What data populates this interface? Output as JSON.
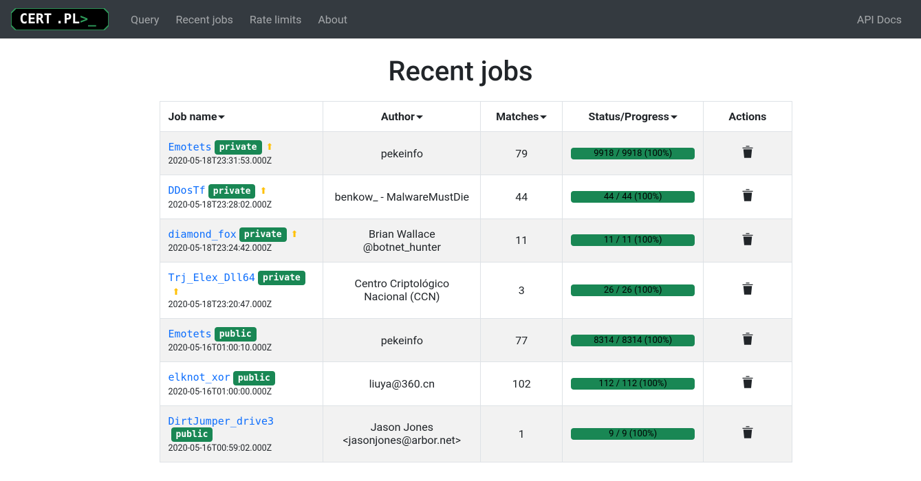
{
  "nav": {
    "logo_text_left": "CERT",
    "logo_text_right": ".PL",
    "links": [
      "Query",
      "Recent jobs",
      "Rate limits",
      "About"
    ],
    "right_link": "API Docs"
  },
  "title": "Recent jobs",
  "columns": {
    "name": "Job name",
    "author": "Author",
    "matches": "Matches",
    "status": "Status/Progress",
    "actions": "Actions"
  },
  "badges": {
    "private": "private",
    "public": "public"
  },
  "rows": [
    {
      "name": "Emotets",
      "badge": "private",
      "warn": true,
      "ts": "2020-05-18T23:31:53.000Z",
      "author": "pekeinfo",
      "matches": "79",
      "progress": "9918 / 9918 (100%)"
    },
    {
      "name": "DDosTf",
      "badge": "private",
      "warn": true,
      "ts": "2020-05-18T23:28:02.000Z",
      "author": "benkow_ - MalwareMustDie",
      "matches": "44",
      "progress": "44 / 44 (100%)"
    },
    {
      "name": "diamond_fox",
      "badge": "private",
      "warn": true,
      "ts": "2020-05-18T23:24:42.000Z",
      "author": "Brian Wallace @botnet_hunter",
      "matches": "11",
      "progress": "11 / 11 (100%)"
    },
    {
      "name": "Trj_Elex_Dll64",
      "badge": "private",
      "warn": true,
      "ts": "2020-05-18T23:20:47.000Z",
      "author": "Centro Criptológico Nacional (CCN)",
      "matches": "3",
      "progress": "26 / 26 (100%)"
    },
    {
      "name": "Emotets",
      "badge": "public",
      "warn": false,
      "ts": "2020-05-16T01:00:10.000Z",
      "author": "pekeinfo",
      "matches": "77",
      "progress": "8314 / 8314 (100%)"
    },
    {
      "name": "elknot_xor",
      "badge": "public",
      "warn": false,
      "ts": "2020-05-16T01:00:00.000Z",
      "author": "liuya@360.cn",
      "matches": "102",
      "progress": "112 / 112 (100%)"
    },
    {
      "name": "DirtJumper_drive3",
      "badge": "public",
      "warn": false,
      "ts": "2020-05-16T00:59:02.000Z",
      "author": "Jason Jones <jasonjones@arbor.net>",
      "matches": "1",
      "progress": "9 / 9 (100%)"
    }
  ]
}
